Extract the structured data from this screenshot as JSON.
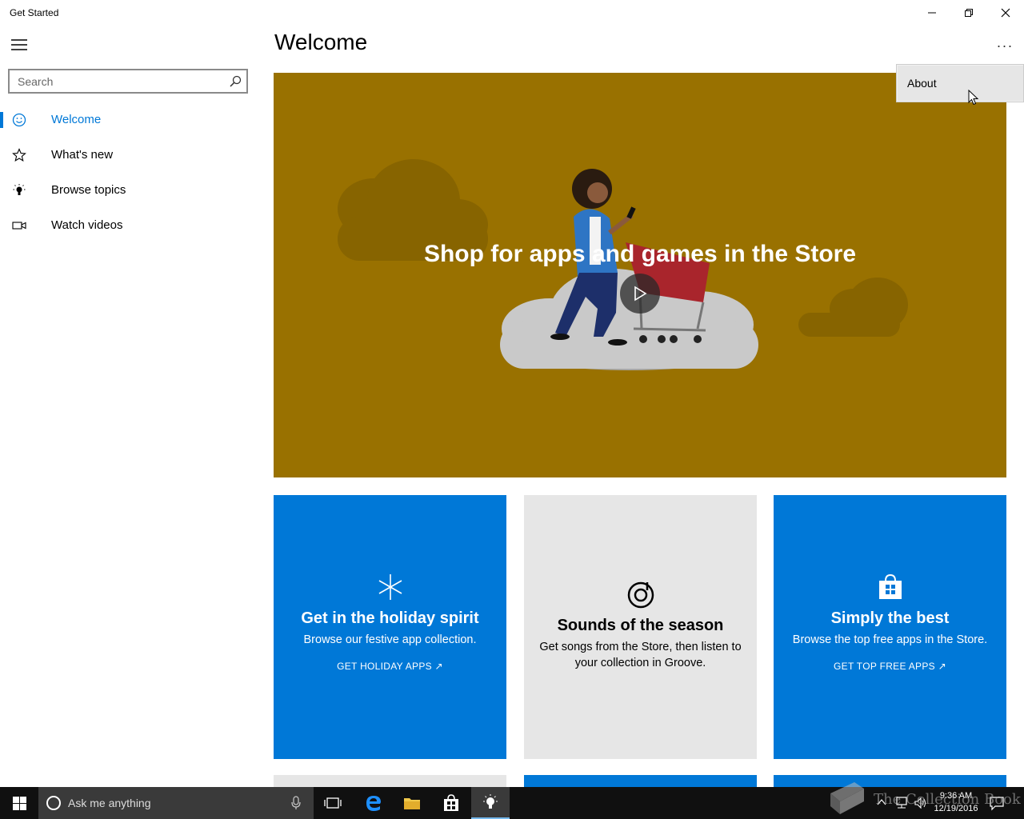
{
  "window": {
    "title": "Get Started",
    "minimize_icon": "minimize-icon",
    "restore_icon": "restore-icon",
    "close_icon": "close-icon"
  },
  "sidebar": {
    "search_placeholder": "Search",
    "items": [
      {
        "label": "Welcome",
        "icon": "smiley-icon",
        "active": true
      },
      {
        "label": "What's new",
        "icon": "star-icon",
        "active": false
      },
      {
        "label": "Browse topics",
        "icon": "lightbulb-icon",
        "active": false
      },
      {
        "label": "Watch videos",
        "icon": "video-camera-icon",
        "active": false
      }
    ]
  },
  "main": {
    "title": "Welcome",
    "more_label": "···",
    "menu": {
      "items": [
        {
          "label": "About"
        }
      ]
    },
    "hero": {
      "title": "Shop for apps and games in the Store",
      "background": "#997100"
    },
    "tiles": [
      {
        "title": "Get in the holiday spirit",
        "text": "Browse our festive app collection.",
        "link": "GET HOLIDAY APPS ↗",
        "icon": "snowflake-icon",
        "color": "#0078d7"
      },
      {
        "title": "Sounds of the season",
        "text": "Get songs from the Store, then listen to your collection in Groove.",
        "link": "",
        "icon": "groove-music-icon",
        "color": "#e6e6e6"
      },
      {
        "title": "Simply the best",
        "text": "Browse the top free apps in the Store.",
        "link": "GET TOP FREE APPS ↗",
        "icon": "store-bag-icon",
        "color": "#0078d7"
      }
    ]
  },
  "taskbar": {
    "cortana_placeholder": "Ask me anything",
    "time": "9:36 AM",
    "date": "12/19/2016",
    "watermark": "The Collection Book",
    "accent": "#76b9ed"
  }
}
